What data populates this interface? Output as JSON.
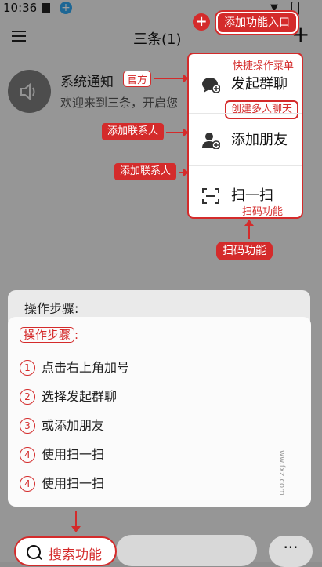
{
  "status": {
    "time": "10:36"
  },
  "header": {
    "title": "三条(1)"
  },
  "conversation": {
    "name": "系统通知",
    "badge": "官方",
    "preview": "欢迎来到三条，开启您"
  },
  "menu": {
    "items": [
      {
        "label": "发起群聊",
        "icon": "group-chat-icon"
      },
      {
        "label": "添加朋友",
        "icon": "add-friend-icon"
      },
      {
        "label": "扫一扫",
        "icon": "scan-icon"
      }
    ]
  },
  "annotations": {
    "entry": "添加功能入口",
    "menu_caption": "快捷操作菜单",
    "group_chat": "创建多人聊天",
    "add_contact_1": "添加联系人",
    "add_contact_2": "添加联系人",
    "scan_inner": "扫码功能",
    "scan_outer": "扫码功能",
    "search": "搜索功能"
  },
  "steps": {
    "back_label": "操作步骤:",
    "heading": "操作步骤",
    "heading_colon": ":",
    "items": [
      {
        "num": "1",
        "text": "点击右上角加号"
      },
      {
        "num": "2",
        "text": "选择发起群聊"
      },
      {
        "num": "3",
        "text": "或添加朋友"
      },
      {
        "num": "4",
        "text": "使用扫一扫"
      },
      {
        "num": "4",
        "text": "使用扫一扫"
      }
    ]
  },
  "watermark": "ww.fxz.com",
  "bottom": {
    "more": "···"
  },
  "colors": {
    "accent": "#d42b2b"
  }
}
